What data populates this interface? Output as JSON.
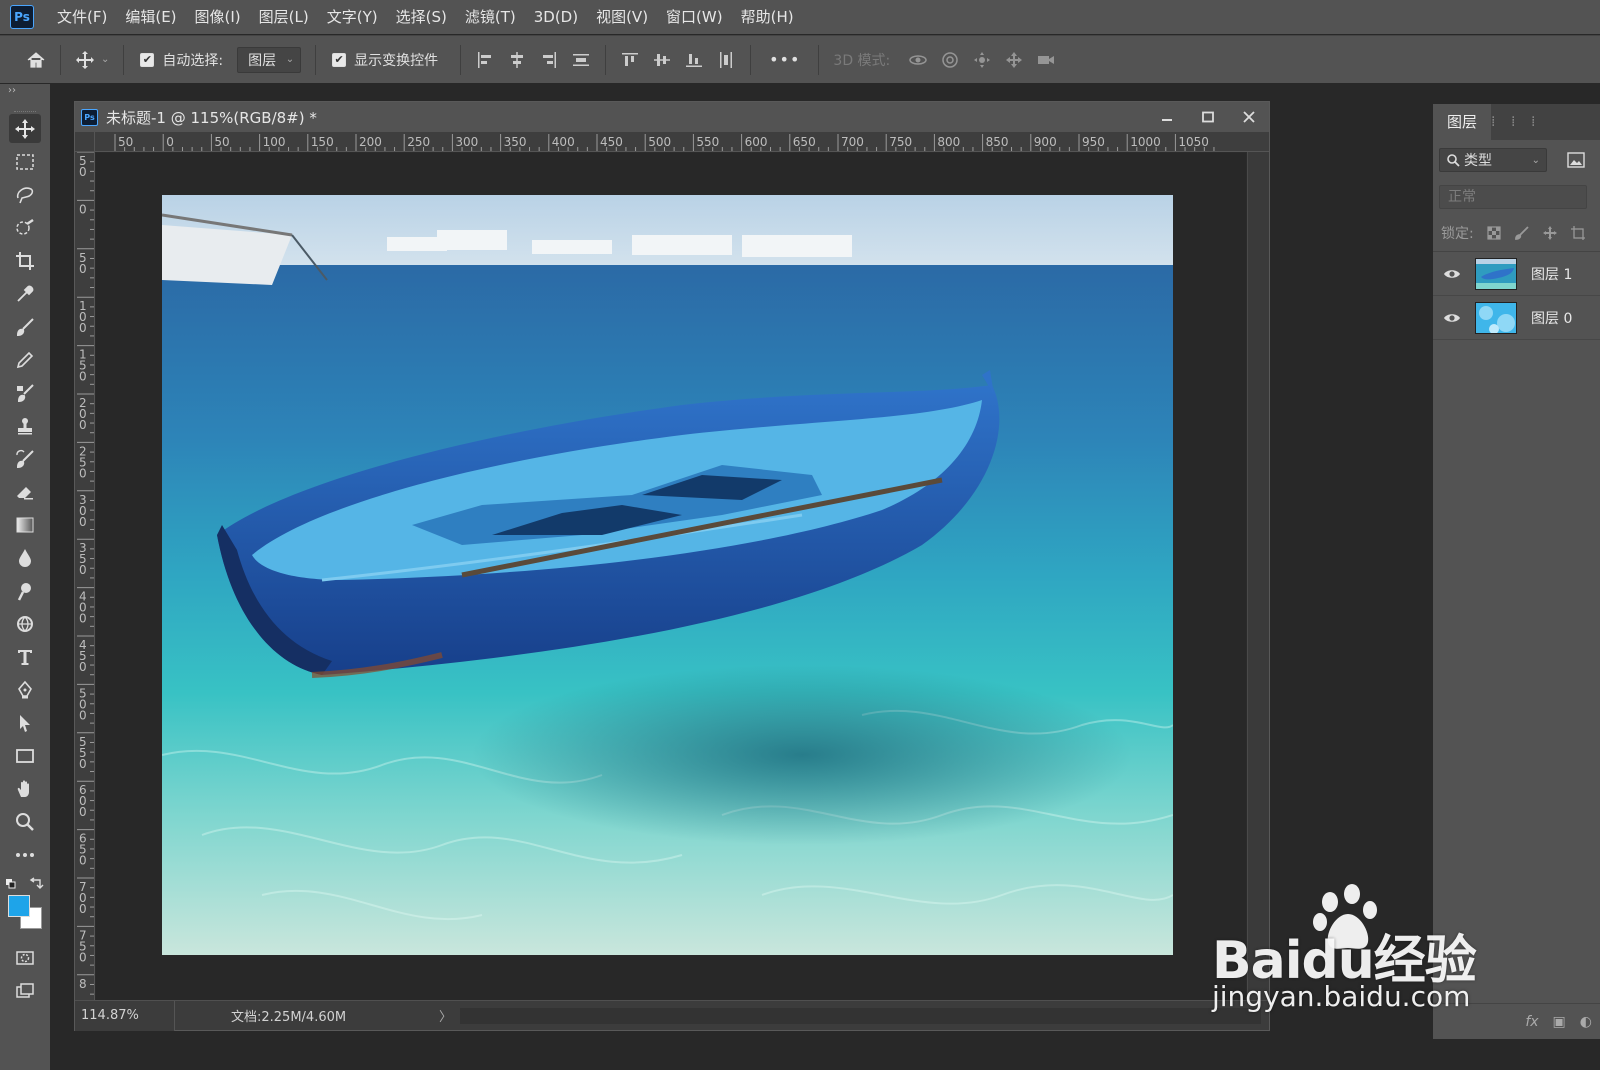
{
  "app": {
    "logo": "Ps"
  },
  "menu": [
    "文件(F)",
    "编辑(E)",
    "图像(I)",
    "图层(L)",
    "文字(Y)",
    "选择(S)",
    "滤镜(T)",
    "3D(D)",
    "视图(V)",
    "窗口(W)",
    "帮助(H)"
  ],
  "options": {
    "auto_select_label": "自动选择:",
    "auto_select_checked": "✔",
    "auto_select_value": "图层",
    "show_transform_label": "显示变换控件",
    "show_transform_checked": "✔",
    "more": "•••",
    "mode_3d_label": "3D 模式:"
  },
  "document": {
    "title": "未标题-1 @ 115%(RGB/8#) *",
    "zoom": "114.87%",
    "doc_info": "文档:2.25M/4.60M",
    "status_arrow": "〉",
    "ruler_h": [
      "50",
      "0",
      "50",
      "100",
      "150",
      "200",
      "250",
      "300",
      "350",
      "400",
      "450",
      "500",
      "550",
      "600",
      "650",
      "700",
      "750",
      "800",
      "850",
      "900",
      "950",
      "1000",
      "1050"
    ],
    "ruler_v": [
      "50",
      "0",
      "50",
      "100",
      "150",
      "200",
      "250",
      "300",
      "350",
      "400",
      "450",
      "500",
      "550",
      "600",
      "650",
      "700",
      "750",
      "8"
    ]
  },
  "layers_panel": {
    "tab": "图层",
    "filter_kind": "类型",
    "blend_mode": "正常",
    "lock_label": "锁定:",
    "layers": [
      {
        "name": "图层 1"
      },
      {
        "name": "图层 0"
      }
    ],
    "fx": "fx"
  },
  "colors": {
    "foreground": "#1ea4e9",
    "background": "#ffffff"
  },
  "watermark": {
    "brand": "Baidu经验",
    "url": "jingyan.baidu.com"
  }
}
